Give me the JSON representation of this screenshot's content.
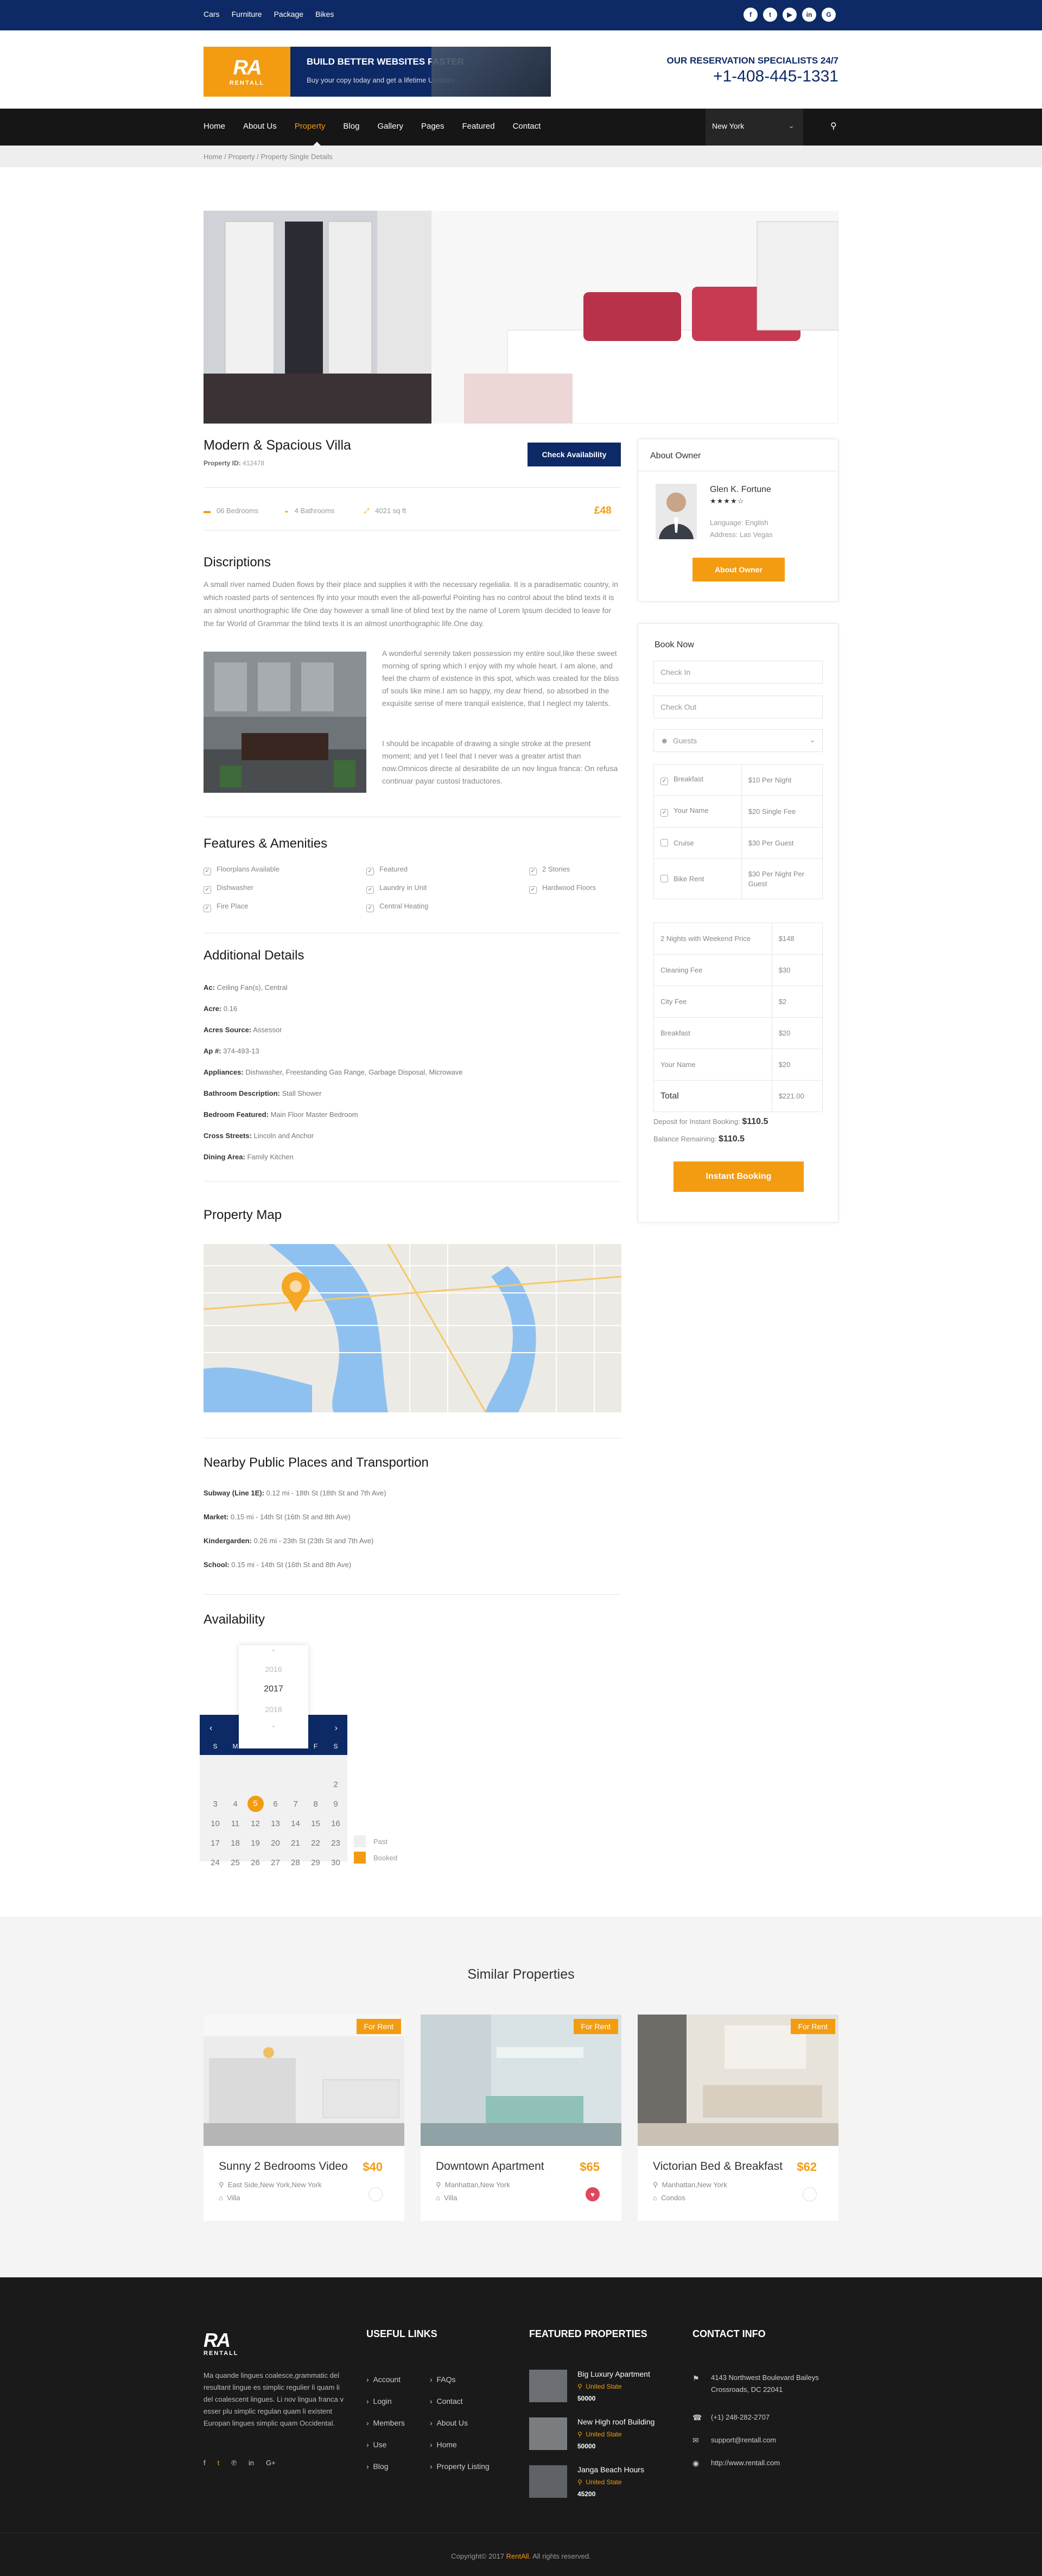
{
  "topbar": {
    "links": [
      "Cars",
      "Furniture",
      "Package",
      "Bikes"
    ],
    "socials": [
      "facebook",
      "twitter",
      "youtube",
      "linkedin",
      "google-plus"
    ]
  },
  "brand": {
    "logo_mark": "RA",
    "logo_name": "RENTALL",
    "banner_title": "BUILD BETTER WEBSITES FASTER",
    "banner_sub": "Buy your copy today and get a lifetime Updates"
  },
  "contact": {
    "label": "OUR RESERVATION SPECIALISTS 24/7",
    "phone": "+1-408-445-1331"
  },
  "nav": {
    "items": [
      "Home",
      "About Us",
      "Property",
      "Blog",
      "Gallery",
      "Pages",
      "Featured",
      "Contact"
    ],
    "active": "Property",
    "city": "New York"
  },
  "breadcrumb": "Home / Property / Property Single Details",
  "property": {
    "title": "Modern & Spacious Villa",
    "id_label": "Property ID:",
    "id": "412478",
    "check_btn": "Check Availability",
    "beds": "06 Bedrooms",
    "baths": "4 Bathrooms",
    "area": "4021 sq ft",
    "price": "£48"
  },
  "desc": {
    "heading": "Discriptions",
    "p1": "A small river named Duden flows by their place and supplies it with the necessary regelialia. It is a paradisematic country, in which roasted parts of sentences fly into your mouth even the all-powerful Pointing has no control about the blind texts it is an almost unorthographic life One day however a small line of blind text by the name of Lorem Ipsum decided to leave for the far World of Grammar the blind texts it is an almost unorthographic life.One day.",
    "p2": "A wonderful serenity taken possession my entire soul,like these sweet morning of spring which I enjoy with my whole heart. I am alone, and feel the charm of existence in this spot, which was created for the bliss of souls like mine.I am so happy, my dear friend, so absorbed in the exquisite sense of mere tranquil existence, that I neglect my talents.",
    "p3": "I should be incapable of drawing a single stroke at the present moment; and yet I feel that I never was a greater artist than now.Omnicos directe al desirabilite de un nov lingua franca: On refusa continuar payar custosi traductores."
  },
  "features": {
    "heading": "Features & Amenities",
    "items": [
      "Floorplans Available",
      "Featured",
      "2 Stories",
      "Dishwasher",
      "Laundry in Unit",
      "Hardwood Floors",
      "Fire Place",
      "Central Heating"
    ]
  },
  "details": {
    "heading": "Additional Details",
    "rows": [
      [
        "Ac:",
        "Ceiling Fan(s), Central"
      ],
      [
        "Acre:",
        "0.16"
      ],
      [
        "Acres Source:",
        "Assessor"
      ],
      [
        "Ap #:",
        "374-493-13"
      ],
      [
        "Appliances:",
        "Dishwasher, Freestanding Gas Range, Garbage Disposal, Microwave"
      ],
      [
        "Bathroom Description:",
        "Stall Shower"
      ],
      [
        "Bedroom Featured:",
        "Main Floor Master Bedroom"
      ],
      [
        "Cross Streets:",
        "Lincoln and Anchor"
      ],
      [
        "Dining Area:",
        "Family Kitchen"
      ]
    ]
  },
  "map": {
    "heading": "Property Map"
  },
  "nearby": {
    "heading": "Nearby Public Places and Transportion",
    "rows": [
      [
        "Subway (Line 1E):",
        "0.12 mi - 18th St (18th St and 7th Ave)"
      ],
      [
        "Market:",
        "0.15 mi - 14th St (16th St and 8th Ave)"
      ],
      [
        "Kindergarden:",
        "0.26 mi - 23th St (23th St and 7th Ave)"
      ],
      [
        "School:",
        "0.15 mi - 14th St (16th St and 8th Ave)"
      ]
    ]
  },
  "availability": {
    "heading": "Availability",
    "years": [
      "2016",
      "2017",
      "2018"
    ],
    "days": [
      "S",
      "M",
      "T",
      "W",
      "T",
      "F",
      "S"
    ],
    "weeks": [
      [
        "",
        "",
        "",
        "",
        "",
        "",
        "2"
      ],
      [
        "3",
        "4",
        "5",
        "6",
        "7",
        "8",
        "9"
      ],
      [
        "10",
        "11",
        "12",
        "13",
        "14",
        "15",
        "16"
      ],
      [
        "17",
        "18",
        "19",
        "20",
        "21",
        "22",
        "23"
      ],
      [
        "24",
        "25",
        "26",
        "27",
        "28",
        "29",
        "30"
      ]
    ],
    "selected": "5",
    "legend_past": "Past",
    "legend_booked": "Booked"
  },
  "owner": {
    "heading": "About Owner",
    "name": "Glen K. Fortune",
    "stars": "★★★★☆",
    "language": "Language: English",
    "address": "Address: Las Vegas",
    "btn": "About Owner"
  },
  "booking": {
    "heading": "Book Now",
    "checkin": "Check In",
    "checkout": "Check Out",
    "guests": "Guests",
    "extras": [
      [
        "Breakfast",
        "$10 Per Night",
        true
      ],
      [
        "Your Name",
        "$20 Single Fee",
        true
      ],
      [
        "Cruise",
        "$30 Per Guest",
        false
      ],
      [
        "Bike Rent",
        "$30 Per Night Per Guest",
        false
      ]
    ],
    "summary": [
      [
        "2 Nights with Weekend Price",
        "$148"
      ],
      [
        "Cleaning Fee",
        "$30"
      ],
      [
        "City Fee",
        "$2"
      ],
      [
        "Breakfast",
        "$20"
      ],
      [
        "Your Name",
        "$20"
      ],
      [
        "Total",
        "$221.00"
      ]
    ],
    "deposit_label": "Deposit for Instant Booking:",
    "deposit": "$110.5",
    "balance_label": "Balance Remaining:",
    "balance": "$110.5",
    "btn": "Instant Booking"
  },
  "similar": {
    "heading": "Similar Properties",
    "items": [
      {
        "tag": "For Rent",
        "name": "Sunny 2 Bedrooms Video",
        "price": "$40",
        "loc": "East Side,New York,New York",
        "type": "Villa"
      },
      {
        "tag": "For Rent",
        "name": "Downtown Apartment",
        "price": "$65",
        "loc": "Manhattan,New York",
        "type": "Villa"
      },
      {
        "tag": "For Rent",
        "name": "Victorian Bed & Breakfast",
        "price": "$62",
        "loc": "Manhattan,New York",
        "type": "Condos"
      }
    ]
  },
  "footer": {
    "about": "Ma quande lingues coalesce,grammatic del resultant lingue es simplic regulier li quam li del coalescent lingues. Li nov lingua franca v esser plu simplic regulan quam li existent Europan lingues simplic quam Occidental.",
    "useful_heading": "USEFUL LINKS",
    "useful_col1": [
      "Account",
      "Login",
      "Members",
      "Use",
      "Blog"
    ],
    "useful_col2": [
      "FAQs",
      "Contact",
      "About Us",
      "Home",
      "Property Listing"
    ],
    "featured_heading": "FEATURED PROPERTIES",
    "featured": [
      {
        "name": "Big Luxury Apartment",
        "loc": "United State",
        "price": "50000"
      },
      {
        "name": "New High roof Building",
        "loc": "United State",
        "price": "50000"
      },
      {
        "name": "Janga Beach Hours",
        "loc": "United State",
        "price": "45200"
      }
    ],
    "contact_heading": "CONTACT INFO",
    "address": "4143 Northwest Boulevard Baileys Crossroads, DC 22041",
    "phone": "(+1) 248-282-2707",
    "email": "support@rentall.com",
    "web": "http://www.rentall.com",
    "copyright_pre": "Copyright© 2017 ",
    "copyright_brand": "RentAll",
    "copyright_post": ". All rights reserved."
  }
}
